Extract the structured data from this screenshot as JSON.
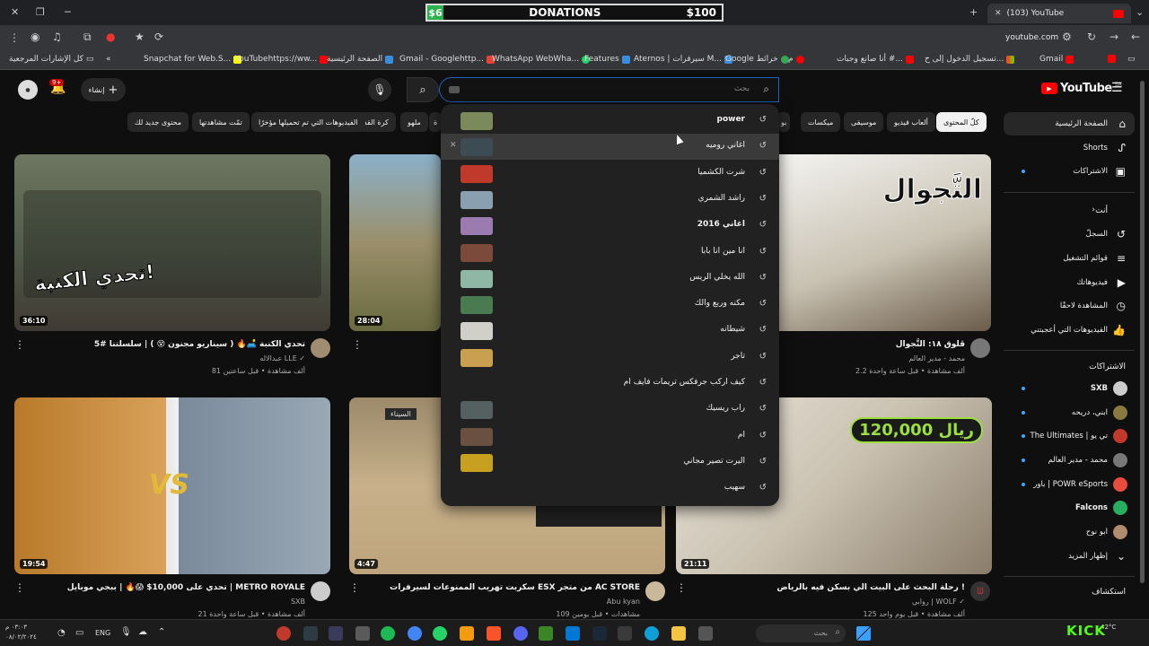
{
  "browser": {
    "tab_title": "(103) YouTube",
    "url": "youtube.com",
    "bookmarks": [
      "كل الإشارات المرجعية",
      "Snapchat for Web.S...",
      "YouTubehttps://ww...",
      "الصفحة الرئيسية",
      "Gmail - Googlehttp...",
      "WhatsApp WebWha...",
      "Features",
      "Aternos | سيرفرات M...",
      "Google خرائط",
      "م",
      "أنا صانع وجبات #...",
      "تسجيل الدخول إلى ح...",
      "Gmail"
    ]
  },
  "overlay": {
    "donations_title": "DONATIONS",
    "donations_current": "$6",
    "donations_goal": "$100"
  },
  "header": {
    "logo_text": "YouTube",
    "logo_country": "SA",
    "search_placeholder": "بحث",
    "create_label": "إنشاء",
    "notifications_badge": "9+"
  },
  "chips": [
    "كلّ المحتوى",
    "ألعاب فيديو",
    "موسيقى",
    "ميكسات",
    "بو",
    "ة",
    "ملهو",
    "كرة القدم",
    "الفيديوهات التي تم تحميلها مؤخرًا",
    "تمّت مشاهدتها",
    "محتوى جديد لك"
  ],
  "sidebar": {
    "main": [
      {
        "label": "الصفحة الرئيسية",
        "icon": "home-icon"
      },
      {
        "label": "Shorts",
        "icon": "shorts-icon"
      },
      {
        "label": "الاشتراكات",
        "icon": "subscriptions-icon"
      }
    ],
    "you_heading": "أنت",
    "you": [
      {
        "label": "السجلّ",
        "icon": "history-icon"
      },
      {
        "label": "قوائم التشغيل",
        "icon": "playlist-icon"
      },
      {
        "label": "فيديوهاتك",
        "icon": "your-videos-icon"
      },
      {
        "label": "المشاهدة لاحقًا",
        "icon": "watch-later-icon"
      },
      {
        "label": "الفيديوهات التي أعجبتني",
        "icon": "like-icon"
      }
    ],
    "subs_heading": "الاشتراكات",
    "subs": [
      {
        "label": "SXB",
        "color": "#cccccc"
      },
      {
        "label": "ابني، دريحه",
        "color": "#8a7a40"
      },
      {
        "label": "The Ultimates | تي يو",
        "color": "#c0392b"
      },
      {
        "label": "محمد - مدير العالم",
        "color": "#777777"
      },
      {
        "label": "باور | POWR eSports",
        "color": "#e74c3c"
      },
      {
        "label": "Falcons",
        "color": "#27ae60"
      },
      {
        "label": "ابو نوح",
        "color": "#b08c6e"
      }
    ],
    "show_more": "إظهار المزيد",
    "explore_heading": "استكشاف"
  },
  "suggestions": [
    {
      "text": "power",
      "bold": true,
      "color": "#7a8a5a"
    },
    {
      "text": "اغاني روميه",
      "bold": false,
      "color": "#3d4b55"
    },
    {
      "text": "شرت الكشميا",
      "bold": false,
      "color": "#c0392b"
    },
    {
      "text": "راشد الشمري",
      "bold": false,
      "color": "#8aa0b0"
    },
    {
      "text": "اغاني 2016",
      "bold": true,
      "color": "#9b7bb0"
    },
    {
      "text": "انا مين انا بابا",
      "bold": false,
      "color": "#7b4a3a"
    },
    {
      "text": "الله يخلي الريس",
      "bold": false,
      "color": "#8fb7a6"
    },
    {
      "text": "مكنه وربع والك",
      "bold": false,
      "color": "#4a7a50"
    },
    {
      "text": "شيطانه",
      "bold": false,
      "color": "#d0d0c8"
    },
    {
      "text": "تاجر",
      "bold": false,
      "color": "#c8a050"
    },
    {
      "text": "كيف اركب جرفكس تريمات فايف ام",
      "bold": false,
      "color": ""
    },
    {
      "text": "راب ريسيك",
      "bold": false,
      "color": "#556060"
    },
    {
      "text": "ام",
      "bold": false,
      "color": "#6a5040"
    },
    {
      "text": "اليرت تصير مجاني",
      "bold": false,
      "color": "#c8a020"
    },
    {
      "text": "سهيب",
      "bold": false,
      "color": ""
    }
  ],
  "videos": [
    {
      "title": "تحدي الكنبة 🛋️🔥 ( سيناريو مجنون 😵 ) | سلسلتنا #5",
      "channel": "عبدالاله LLE ✓",
      "meta": "81 ألف مشاهدة • قبل ساعتين",
      "duration": "36:10",
      "thumb_text": "تحدي الكنبة!"
    },
    {
      "title": "",
      "channel": "",
      "meta": "",
      "duration": "28:04",
      "thumb_text": ""
    },
    {
      "title": "ڤلوق ١٨: التَّجوال",
      "channel": "محمد - مدير العالم",
      "meta": "2.2 ألف مشاهدة • قبل ساعة واحدة",
      "duration": "",
      "thumb_text": "التَّجوال"
    },
    {
      "title": "تحدي على 10,000$ 😱🔥 | ببجي موبايل | METRO ROYALE",
      "channel": "SXB",
      "meta": "21 ألف مشاهدة • قبل ساعة واحدة",
      "duration": "19:54",
      "thumb_text": "VS"
    },
    {
      "title": "سكربت تهريب الممنوعات لسيرفرات ESX من متجر AC STORE",
      "channel": "Abu kyan",
      "meta": "109 مشاهدات • قبل يومين",
      "duration": "4:47",
      "thumb_text": "السيناء"
    },
    {
      "title": "رحلة البحث على البيت الي بسكن فيه بالرياض !",
      "channel": "روابي | WOLF ✓",
      "meta": "125 ألف مشاهدة • قبل يوم واحد",
      "duration": "21:11",
      "thumb_text": "120,000 ريال"
    }
  ],
  "taskbar": {
    "search_placeholder": "بحث",
    "lang": "ENG",
    "time": "٠٣:٠٣ م",
    "date": "٠٨/٠٢/٢٠٢٤",
    "temp": "42°C",
    "kick": "KICK"
  }
}
